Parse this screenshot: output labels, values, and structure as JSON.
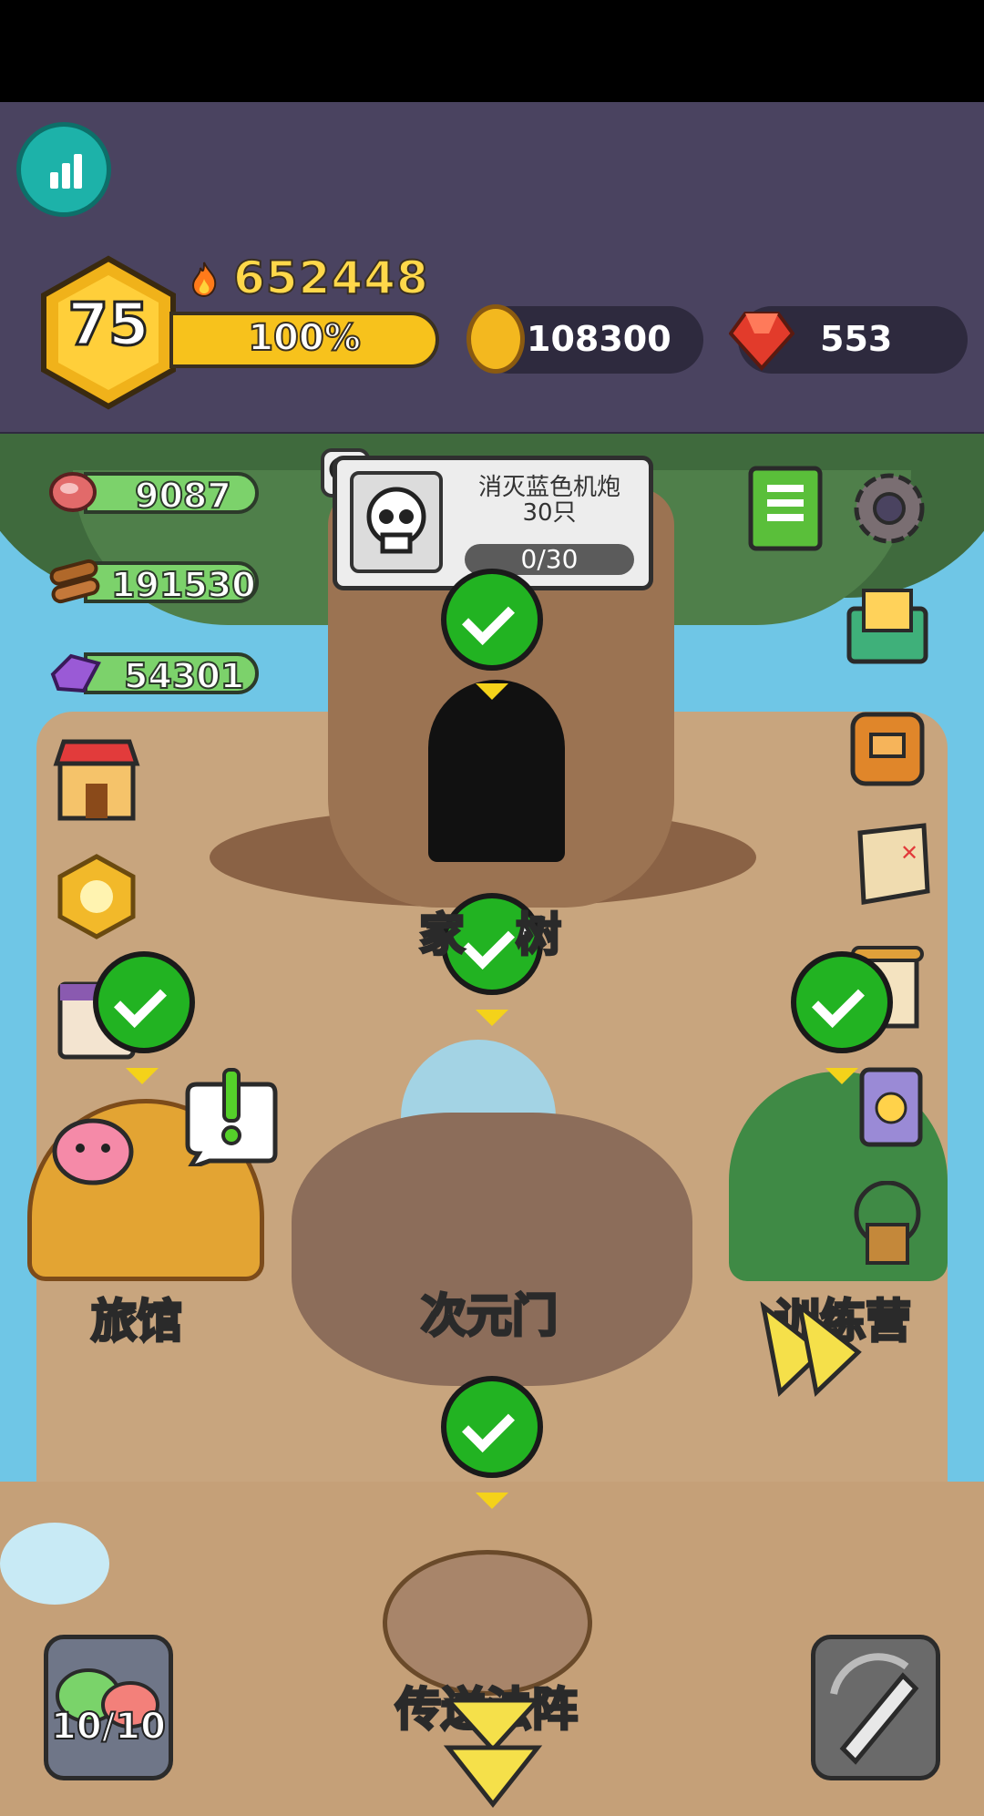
{
  "player": {
    "level": "75",
    "power": "652448",
    "xp_percent_label": "100%",
    "xp_fraction": 1.0
  },
  "currency": {
    "gold": "108300",
    "gems": "553"
  },
  "resources": [
    {
      "name": "meat-icon",
      "value": "9087"
    },
    {
      "name": "wood-icon",
      "value": "191530"
    },
    {
      "name": "crystal-icon",
      "value": "54301"
    }
  ],
  "quest": {
    "title_line1": "消灭蓝色机炮",
    "title_line2": "30只",
    "progress": "0/30",
    "progress_fraction": 0
  },
  "locations": {
    "tree": "家",
    "tree_suffix": "树",
    "inn": "旅馆",
    "portal": "次元门",
    "camp": "训练营",
    "teleport": "传送法阵"
  },
  "bottom": {
    "slime_count": "10/10"
  },
  "colors": {
    "header_bg": "#4a4360",
    "check_green": "#22b322",
    "xp_yellow": "#f7c21c",
    "res_green": "#7cd26b",
    "gold": "#f3b81f",
    "gem": "#e23b2b"
  },
  "icons": {
    "left_column": [
      "shop-icon",
      "reward-medal-icon",
      "calendar-icon",
      "pink-slime-icon"
    ],
    "right_column": [
      "guide-book-icon",
      "settings-icon",
      "mail-icon",
      "backpack-icon",
      "treasure-map-icon",
      "scroll-icon",
      "skull-card-icon",
      "camp-house-icon"
    ]
  }
}
